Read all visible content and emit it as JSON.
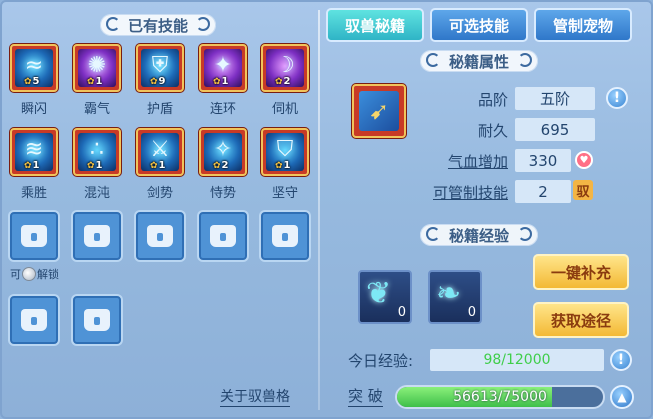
{
  "left": {
    "title": "已有技能",
    "skills": [
      {
        "label": "瞬闪",
        "count": "5",
        "icon": "flash-skill-icon",
        "glyph": "≈",
        "tone": "blue"
      },
      {
        "label": "霸气",
        "count": "1",
        "icon": "domineer-skill-icon",
        "glyph": "✺",
        "tone": "purple"
      },
      {
        "label": "护盾",
        "count": "9",
        "icon": "shield-skill-icon",
        "glyph": "⛨",
        "tone": "blue"
      },
      {
        "label": "连环",
        "count": "1",
        "icon": "chain-skill-icon",
        "glyph": "✦",
        "tone": "purple"
      },
      {
        "label": "伺机",
        "count": "2",
        "icon": "ambush-skill-icon",
        "glyph": "☽",
        "tone": "purple"
      },
      {
        "label": "乘胜",
        "count": "1",
        "icon": "pursuit-skill-icon",
        "glyph": "≋",
        "tone": "blue"
      },
      {
        "label": "混沌",
        "count": "1",
        "icon": "chaos-skill-icon",
        "glyph": "∴",
        "tone": "blue"
      },
      {
        "label": "剑势",
        "count": "1",
        "icon": "sword-skill-icon",
        "glyph": "⚔",
        "tone": "blue"
      },
      {
        "label": "恃势",
        "count": "2",
        "icon": "might-skill-icon",
        "glyph": "✧",
        "tone": "blue"
      },
      {
        "label": "坚守",
        "count": "1",
        "icon": "guard-skill-icon",
        "glyph": "⛉",
        "tone": "blue"
      }
    ],
    "unlock_note_prefix": "可",
    "unlock_note_suffix": "解锁",
    "bottom_link": "关于驭兽格"
  },
  "tabs": [
    {
      "label": "驭兽秘籍",
      "active": true
    },
    {
      "label": "可选技能",
      "active": false
    },
    {
      "label": "管制宠物",
      "active": false
    }
  ],
  "attrs": {
    "title": "秘籍属性",
    "grade_label": "品阶",
    "grade_value": "五阶",
    "durability_label": "耐久",
    "durability_value": "695",
    "hp_label": "气血增加",
    "hp_value": "330",
    "control_label": "可管制技能",
    "control_value": "2",
    "control_badge": "驭"
  },
  "exp": {
    "title": "秘籍经验",
    "items": [
      {
        "icon": "blue-spirit-icon",
        "count": "0"
      },
      {
        "icon": "blue-beast-icon",
        "count": "0"
      }
    ],
    "refill_button": "一键补充",
    "obtain_button": "获取途径",
    "today_label": "今日经验:",
    "today_value": "98/12000",
    "break_label": "突 破",
    "break_value": "56613/75000",
    "break_current": 56613,
    "break_max": 75000
  }
}
